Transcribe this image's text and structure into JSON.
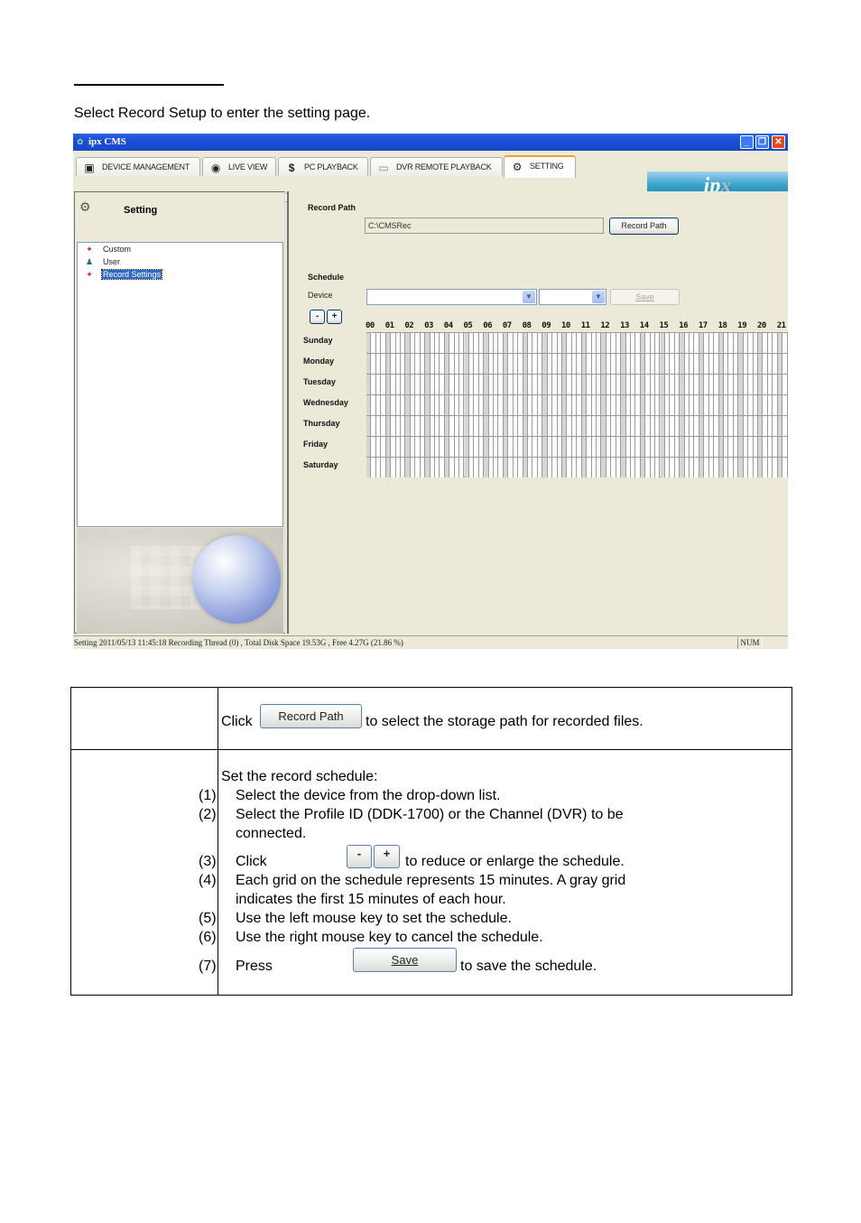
{
  "doc": {
    "intro": "Select Record Setup to enter the setting page."
  },
  "window": {
    "title": "ipx CMS",
    "controls": {
      "minimize": "_",
      "maximize": "❐",
      "close": "✕"
    },
    "tabs": [
      {
        "label": "DEVICE MANAGEMENT",
        "icon": "device-icon",
        "active": false
      },
      {
        "label": "LIVE VIEW",
        "icon": "eye-icon",
        "active": false
      },
      {
        "label": "PC PLAYBACK",
        "icon": "dollar-icon",
        "active": false
      },
      {
        "label": "DVR REMOTE PLAYBACK",
        "icon": "dvr-icon",
        "active": false
      },
      {
        "label": "SETTING",
        "icon": "setting-icon",
        "active": true
      }
    ],
    "brand": {
      "main": "ip",
      "accent": "x"
    },
    "left_pane": {
      "title": "Setting",
      "tree": [
        {
          "label": "Custom",
          "icon": "gear-icon",
          "selected": false
        },
        {
          "label": "User",
          "icon": "user-icon",
          "selected": false
        },
        {
          "label": "Record Settings",
          "icon": "gear-icon",
          "selected": true
        }
      ]
    },
    "right_pane": {
      "record_path_label": "Record Path",
      "record_path_value": "C:\\CMSRec",
      "record_path_button": "Record Path",
      "schedule_label": "Schedule",
      "device_label": "Device",
      "device_value": "",
      "channel_value": "",
      "save_button": "Save",
      "zoom_out": "-",
      "zoom_in": "+",
      "hours": [
        "00",
        "01",
        "02",
        "03",
        "04",
        "05",
        "06",
        "07",
        "08",
        "09",
        "10",
        "11",
        "12",
        "13",
        "14",
        "15",
        "16",
        "17",
        "18",
        "19",
        "20",
        "21"
      ],
      "days": [
        "Sunday",
        "Monday",
        "Tuesday",
        "Wednesday",
        "Thursday",
        "Friday",
        "Saturday"
      ],
      "slots_per_hour": 4
    },
    "statusbar": {
      "message": "Setting   2011/05/13 11:45:18   Recording Thread (0) , Total Disk Space 19.53G , Free 4.27G  (21.86 %)",
      "num": "NUM"
    },
    "colors": {
      "titlebar": "#1a4fd6",
      "selection": "#316ac5",
      "first_slot": "#d6d6d6",
      "window_bg": "#ece9d8"
    }
  },
  "table": {
    "row1": {
      "pre": "Click",
      "button": "Record Path",
      "post": "to select the storage path for recorded files."
    },
    "row2": {
      "intro": "Set the record schedule:",
      "steps": [
        {
          "num": "(1)",
          "text": "Select the device from the drop-down list."
        },
        {
          "num": "(2)",
          "text": "Select the Profile ID (DDK-1700) or the Channel (DVR) to be",
          "cont": "connected."
        },
        {
          "num": "(3)",
          "pre": "Click",
          "btn_minus": "-",
          "btn_plus": "+",
          "post": "to reduce or enlarge the schedule."
        },
        {
          "num": "(4)",
          "text": "Each grid on the schedule represents 15 minutes. A gray grid",
          "cont": "indicates the first 15 minutes of each hour."
        },
        {
          "num": "(5)",
          "text": "Use the left mouse key to set the schedule."
        },
        {
          "num": "(6)",
          "text": "Use the right mouse key to cancel the schedule."
        },
        {
          "num": "(7)",
          "pre": "Press",
          "button": "Save",
          "post": "to save the schedule."
        }
      ]
    }
  }
}
